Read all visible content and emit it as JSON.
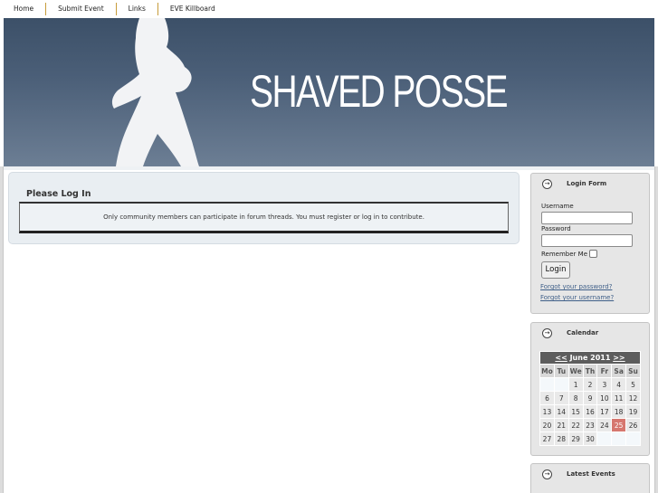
{
  "nav": [
    "Home",
    "Submit Event",
    "Links",
    "EVE Killboard"
  ],
  "banner": {
    "logo_text": "SHAVED POSSE"
  },
  "main": {
    "title": "Please Log In",
    "notice": "Only community members can participate in forum threads. You must register or log in to contribute."
  },
  "login": {
    "title": "Login Form",
    "username_label": "Username",
    "username_value": "",
    "password_label": "Password",
    "password_value": "",
    "remember_label": "Remember Me",
    "remember_checked": false,
    "button_label": "Login",
    "forgot_password": "Forgot your password?",
    "forgot_username": "Forgot your username?"
  },
  "calendar": {
    "title": "Calendar",
    "prev": "<<",
    "month_label": "June 2011",
    "next": ">>",
    "weekdays": [
      "Mo",
      "Tu",
      "We",
      "Th",
      "Fr",
      "Sa",
      "Su"
    ],
    "weeks": [
      [
        "",
        "",
        "1",
        "2",
        "3",
        "4",
        "5"
      ],
      [
        "6",
        "7",
        "8",
        "9",
        "10",
        "11",
        "12"
      ],
      [
        "13",
        "14",
        "15",
        "16",
        "17",
        "18",
        "19"
      ],
      [
        "20",
        "21",
        "22",
        "23",
        "24",
        "25",
        "26"
      ],
      [
        "27",
        "28",
        "29",
        "30",
        "",
        "",
        ""
      ]
    ],
    "highlighted_day": "25",
    "highlight_color": "#d6776f"
  },
  "events": {
    "title": "Latest Events"
  },
  "icons": {
    "module_arrow": "circle-arrow-right-icon"
  }
}
